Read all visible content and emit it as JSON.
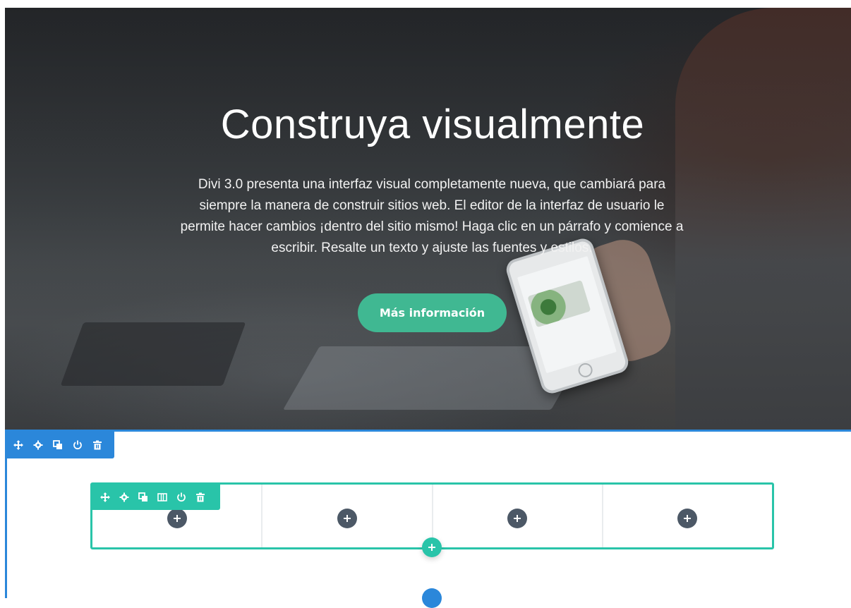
{
  "hero": {
    "title": "Construya visualmente",
    "body": "Divi 3.0 presenta una interfaz visual completamente nueva, que cambiará para siempre la manera de construir sitios web. El editor de la interfaz de usuario le permite hacer cambios ¡dentro del sitio mismo! Haga clic en un párrafo y comience a escribir. Resalte un texto y ajuste las fuentes y estilos.",
    "button_label": "Más información",
    "button_color": "#40b892"
  },
  "section_toolbar": {
    "color": "#2b87da",
    "icons": [
      "move-icon",
      "settings-icon",
      "duplicate-icon",
      "toggle-icon",
      "delete-icon"
    ]
  },
  "row_toolbar": {
    "color": "#29c4a9",
    "icons": [
      "move-icon",
      "settings-icon",
      "duplicate-icon",
      "columns-icon",
      "toggle-icon",
      "delete-icon"
    ]
  },
  "row": {
    "column_count": 4,
    "add_module_icon": "plus-icon",
    "add_row_icon": "plus-icon"
  }
}
